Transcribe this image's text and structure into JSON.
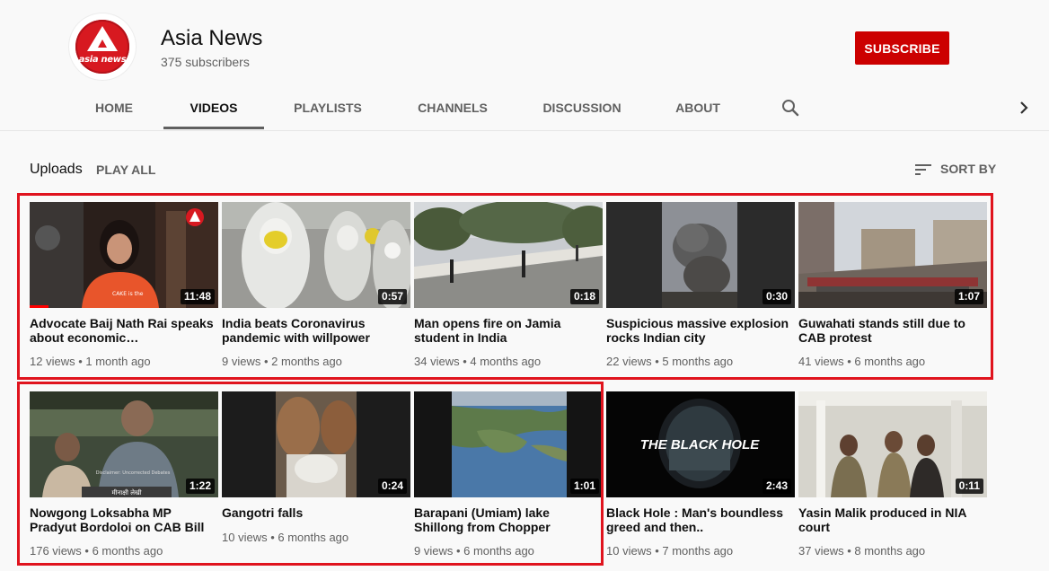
{
  "channel": {
    "name": "Asia News",
    "subscribers": "375 subscribers",
    "subscribe_label": "SUBSCRIBE",
    "logo_text": "asia news",
    "brand_color": "#cc0000"
  },
  "tabs": [
    {
      "label": "HOME",
      "active": false
    },
    {
      "label": "VIDEOS",
      "active": true
    },
    {
      "label": "PLAYLISTS",
      "active": false
    },
    {
      "label": "CHANNELS",
      "active": false
    },
    {
      "label": "DISCUSSION",
      "active": false
    },
    {
      "label": "ABOUT",
      "active": false
    }
  ],
  "tab_icons": {
    "search": "search-icon",
    "next": "chevron-right-icon"
  },
  "section": {
    "title": "Uploads",
    "play_all": "PLAY ALL",
    "sort_label": "SORT BY",
    "sort_icon": "sort-icon"
  },
  "highlight_color": "#e0141e",
  "videos": [
    {
      "title": "Advocate Baij Nath Rai speaks about economic…",
      "views": "12 views",
      "age": "1 month ago",
      "duration": "11:48",
      "watched": 0.1
    },
    {
      "title": "India beats Coronavirus pandemic with willpower",
      "views": "9 views",
      "age": "2 months ago",
      "duration": "0:57"
    },
    {
      "title": "Man opens fire on Jamia student in India",
      "views": "34 views",
      "age": "4 months ago",
      "duration": "0:18"
    },
    {
      "title": "Suspicious massive explosion rocks Indian city",
      "views": "22 views",
      "age": "5 months ago",
      "duration": "0:30"
    },
    {
      "title": "Guwahati stands still due to CAB protest",
      "views": "41 views",
      "age": "6 months ago",
      "duration": "1:07"
    },
    {
      "title": "Nowgong Loksabha MP Pradyut Bordoloi on CAB Bill",
      "views": "176 views",
      "age": "6 months ago",
      "duration": "1:22"
    },
    {
      "title": "Gangotri falls",
      "views": "10 views",
      "age": "6 months ago",
      "duration": "0:24"
    },
    {
      "title": "Barapani (Umiam) lake Shillong from Chopper",
      "views": "9 views",
      "age": "6 months ago",
      "duration": "1:01"
    },
    {
      "title": "Black Hole : Man's boundless greed and then..",
      "views": "10 views",
      "age": "7 months ago",
      "duration": "2:43"
    },
    {
      "title": "Yasin Malik produced in NIA court",
      "views": "37 views",
      "age": "8 months ago",
      "duration": "0:11"
    }
  ],
  "thumbnail_text": {
    "black_hole": "THE BLACK HOLE",
    "cake_shirt": "CAKE is the",
    "banner": "मीनाक्षी लेखी",
    "disclaimer": "Disclaimer: Uncorrected Debates"
  }
}
